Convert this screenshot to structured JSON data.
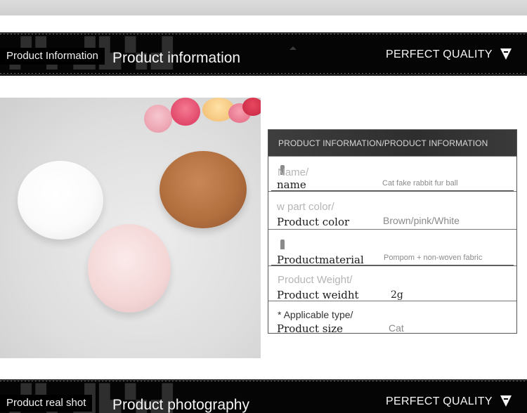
{
  "section1": {
    "banner_label": "Product Information",
    "banner_title": "Product information",
    "banner_right": "PERFECT QUALITY"
  },
  "product_table": {
    "header": "PRODUCT INFORMATION/PRODUCT INFORMATION",
    "rows": [
      {
        "ghost": "Name/",
        "label": "name",
        "value": "Cat fake rabbit fur ball"
      },
      {
        "ghost": "w part color/",
        "label": "Product color",
        "value": "Brown/pink/White"
      },
      {
        "ghost": "",
        "label": "Productmaterial",
        "value": "Pompom + non-woven fabric"
      },
      {
        "ghost": "Product Weight/",
        "label": "Product weidht",
        "value": "2g"
      },
      {
        "ghost": "* Applicable type/",
        "label": "Product size",
        "value": "Cat"
      }
    ]
  },
  "section2": {
    "banner_label": "Product real shot",
    "banner_title": "Product photography",
    "banner_right": "PERFECT QUALITY"
  },
  "colors": {
    "banner_bg": "#050505",
    "table_header_bg": "#3a3a3a",
    "ball_white": "#fbfbfb",
    "ball_brown": "#b3703f",
    "ball_pink": "#f4d6d6"
  }
}
